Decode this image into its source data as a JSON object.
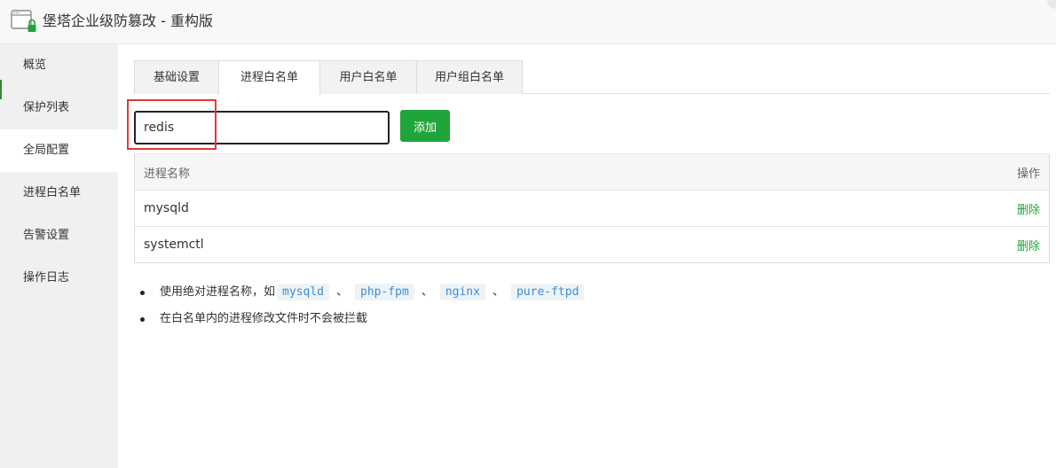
{
  "window": {
    "title": "堡塔企业级防篡改 - 重构版",
    "icon": "app-window-lock-icon"
  },
  "sidebar": {
    "items": [
      {
        "label": "概览",
        "active": false
      },
      {
        "label": "保护列表",
        "active": false
      },
      {
        "label": "全局配置",
        "active": true
      },
      {
        "label": "进程白名单",
        "active": false
      },
      {
        "label": "告警设置",
        "active": false
      },
      {
        "label": "操作日志",
        "active": false
      }
    ]
  },
  "tabs": [
    {
      "label": "基础设置",
      "active": false
    },
    {
      "label": "进程白名单",
      "active": true
    },
    {
      "label": "用户白名单",
      "active": false
    },
    {
      "label": "用户组白名单",
      "active": false
    }
  ],
  "add_form": {
    "input_value": "redis",
    "add_label": "添加"
  },
  "table": {
    "headers": {
      "name": "进程名称",
      "op": "操作"
    },
    "rows": [
      {
        "name": "mysqld",
        "action": "删除"
      },
      {
        "name": "systemctl",
        "action": "删除"
      }
    ]
  },
  "notes": {
    "item1_text": "使用绝对进程名称，如",
    "item1_codes": [
      "mysqld",
      "php-fpm",
      "nginx",
      "pure-ftpd"
    ],
    "item1_sep": "、",
    "item2_text": "在白名单内的进程修改文件时不会被拦截"
  },
  "colors": {
    "accent_green": "#20a53a",
    "highlight_red": "#e53935",
    "code_blue": "#3b8edb"
  }
}
